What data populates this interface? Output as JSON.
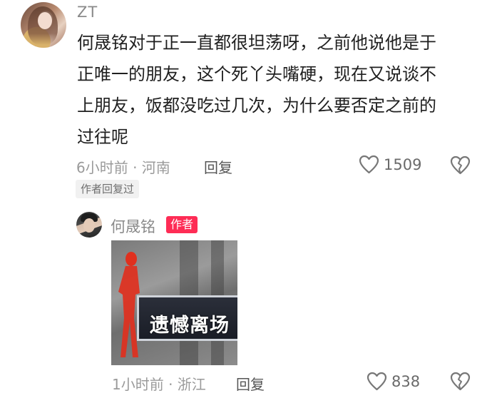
{
  "main_comment": {
    "username": "ZT",
    "text_lines": [
      "何晟铭对于正一直都很坦荡呀，之前他说他是于",
      "正唯一的朋友，这个死丫头嘴硬，现在又说谈不",
      "上朋友，饭都没吃过几次，为什么要否定之前的",
      "过往呢"
    ],
    "meta": "6小时前 · 河南",
    "reply_label": "回复",
    "like_count": "1509",
    "author_replied_tag": "作者回复过"
  },
  "reply_comment": {
    "username": "何晟铭",
    "badge": "作者",
    "sticker_text": "遗憾离场",
    "meta": "1小时前 · 浙江",
    "reply_label": "回复",
    "like_count": "838"
  },
  "icons": {
    "like": "heart-outline-icon",
    "dislike": "broken-heart-icon"
  },
  "colors": {
    "author_badge": "#fe2c55",
    "meta_text": "#9a9a9a"
  }
}
